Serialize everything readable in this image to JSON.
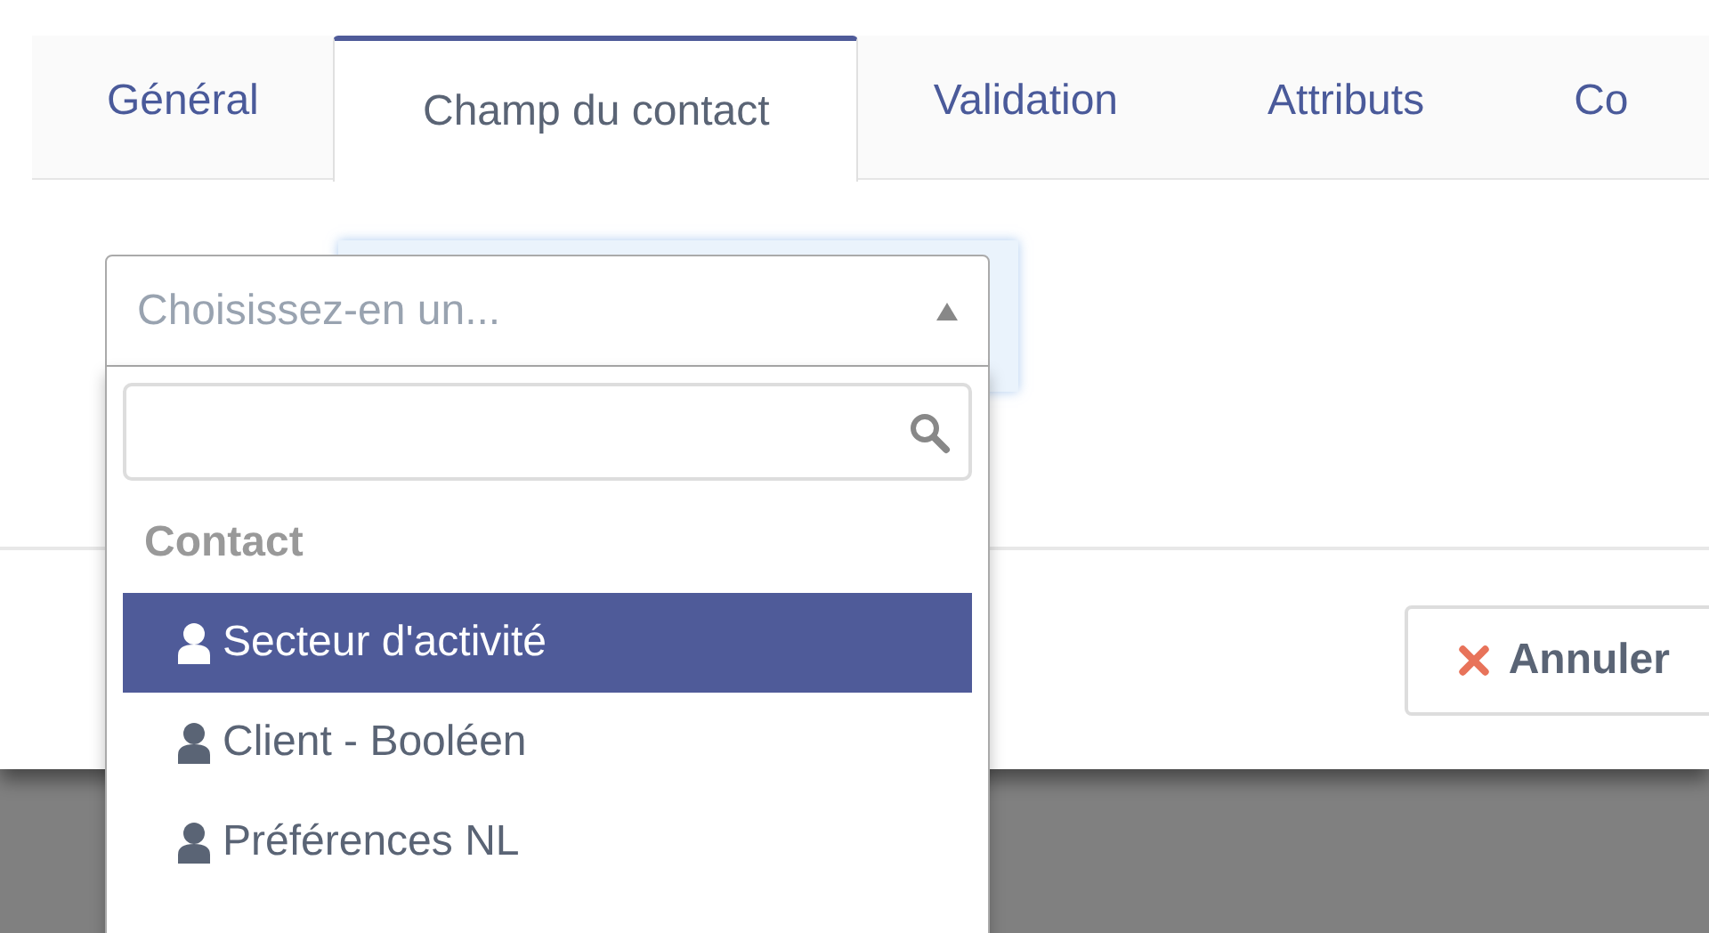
{
  "tabs": [
    {
      "label": "Général",
      "selected": false
    },
    {
      "label": "Champ du contact",
      "selected": true
    },
    {
      "label": "Validation",
      "selected": false
    },
    {
      "label": "Attributs",
      "selected": false
    },
    {
      "label": "Co",
      "selected": false
    }
  ],
  "select": {
    "placeholder": "Choisissez-en un...",
    "expanded": true,
    "groups": [
      {
        "label": "Contact",
        "options": [
          {
            "label": "Secteur d'activité",
            "selected": true
          },
          {
            "label": "Client - Booléen",
            "selected": false
          },
          {
            "label": "Préférences NL",
            "selected": false
          }
        ]
      }
    ]
  },
  "buttons": [
    {
      "label": "Annuler",
      "kind": "cancel"
    }
  ]
}
